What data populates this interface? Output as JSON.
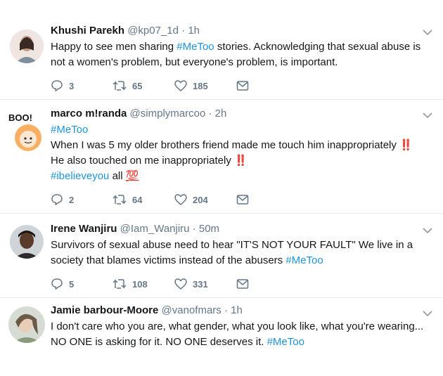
{
  "tweets": [
    {
      "name": "Khushi Parekh",
      "handle": "@kp07_1d",
      "time": "1h",
      "lines": [
        "Happy to see men sharing ",
        "#MeToo",
        " stories. Acknowledging that sexual abuse is not a women's problem, but everyone's problem, is important."
      ],
      "replies": "3",
      "retweets": "65",
      "likes": "185"
    },
    {
      "name": "marco m!randa",
      "handle": "@simplymarcoo",
      "time": "2h",
      "avatar_badge": "BOO!",
      "hashtag": "#MeToo",
      "line1": "When I was 5 my older brothers friend made me touch him inappropriately",
      "line2": "He also touched on me inappropriately",
      "hashtag2": "#ibelieveyou",
      "line3_suffix": " all",
      "emoji_bang": "‼️",
      "emoji_100": "💯",
      "replies": "2",
      "retweets": "64",
      "likes": "204"
    },
    {
      "name": "Irene Wanjiru",
      "handle": "@Iam_Wanjiru",
      "time": "50m",
      "text_a": "Survivors of sexual abuse need to hear \"IT'S NOT YOUR FAULT\" We live in a society that blames victims instead of the abusers ",
      "hashtag": "#MeToo",
      "replies": "5",
      "retweets": "108",
      "likes": "331"
    },
    {
      "name": "Jamie barbour-Moore",
      "handle": "@vanofmars",
      "time": "1h",
      "text_a": "I don't care who you are, what gender, what you look like, what you're wearing... NO ONE is asking for it. NO ONE deserves it. ",
      "hashtag": "#MeToo"
    }
  ],
  "separator": "·",
  "colors": {
    "link": "#1b95e0",
    "muted": "#657786",
    "separator": "#e6ecf0"
  },
  "icons": [
    "reply-icon",
    "retweet-icon",
    "like-icon",
    "dm-icon",
    "chevron-down-icon"
  ]
}
